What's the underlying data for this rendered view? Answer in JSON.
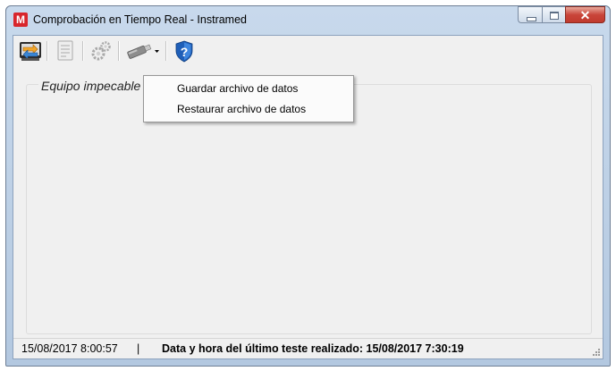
{
  "window": {
    "title": "Comprobación en Tiempo Real - Instramed",
    "app_icon_letter": "M"
  },
  "toolbar": {
    "buttons": [
      {
        "name": "transfer-icon",
        "enabled": true
      },
      {
        "name": "report-icon",
        "enabled": false
      },
      {
        "name": "settings-gears-icon",
        "enabled": false
      },
      {
        "name": "usb-drive-icon",
        "enabled": true,
        "has_dropdown": true
      },
      {
        "name": "help-shield-icon",
        "enabled": true
      }
    ]
  },
  "group": {
    "label": "Equipo impecable"
  },
  "menu": {
    "items": [
      {
        "label": "Guardar archivo de datos"
      },
      {
        "label": "Restaurar archivo de datos"
      }
    ]
  },
  "statusbar": {
    "datetime": "15/08/2017 8:00:57",
    "separator": "|",
    "last_test": "Data y hora del último teste realizado: 15/08/2017 7:30:19"
  },
  "colors": {
    "close_button": "#c9453a",
    "help_icon": "#1f5fb8",
    "app_icon": "#d8262c"
  }
}
